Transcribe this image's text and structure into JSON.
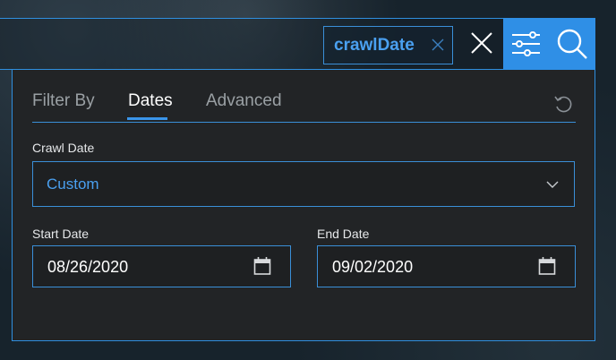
{
  "search": {
    "chip_label": "crawlDate"
  },
  "tabs": [
    {
      "label": "Filter By",
      "active": false
    },
    {
      "label": "Dates",
      "active": true
    },
    {
      "label": "Advanced",
      "active": false
    }
  ],
  "crawl_date": {
    "label": "Crawl Date",
    "selected": "Custom"
  },
  "start_date": {
    "label": "Start Date",
    "value": "08/26/2020"
  },
  "end_date": {
    "label": "End Date",
    "value": "09/02/2020"
  },
  "colors": {
    "accent": "#2f8fe6",
    "panel": "#222426",
    "border": "#3a8fd8",
    "accent_text": "#4aa0f0"
  },
  "icons": [
    "close-icon",
    "filter-sliders-icon",
    "search-icon",
    "reset-icon",
    "chevron-down-icon",
    "calendar-icon"
  ]
}
